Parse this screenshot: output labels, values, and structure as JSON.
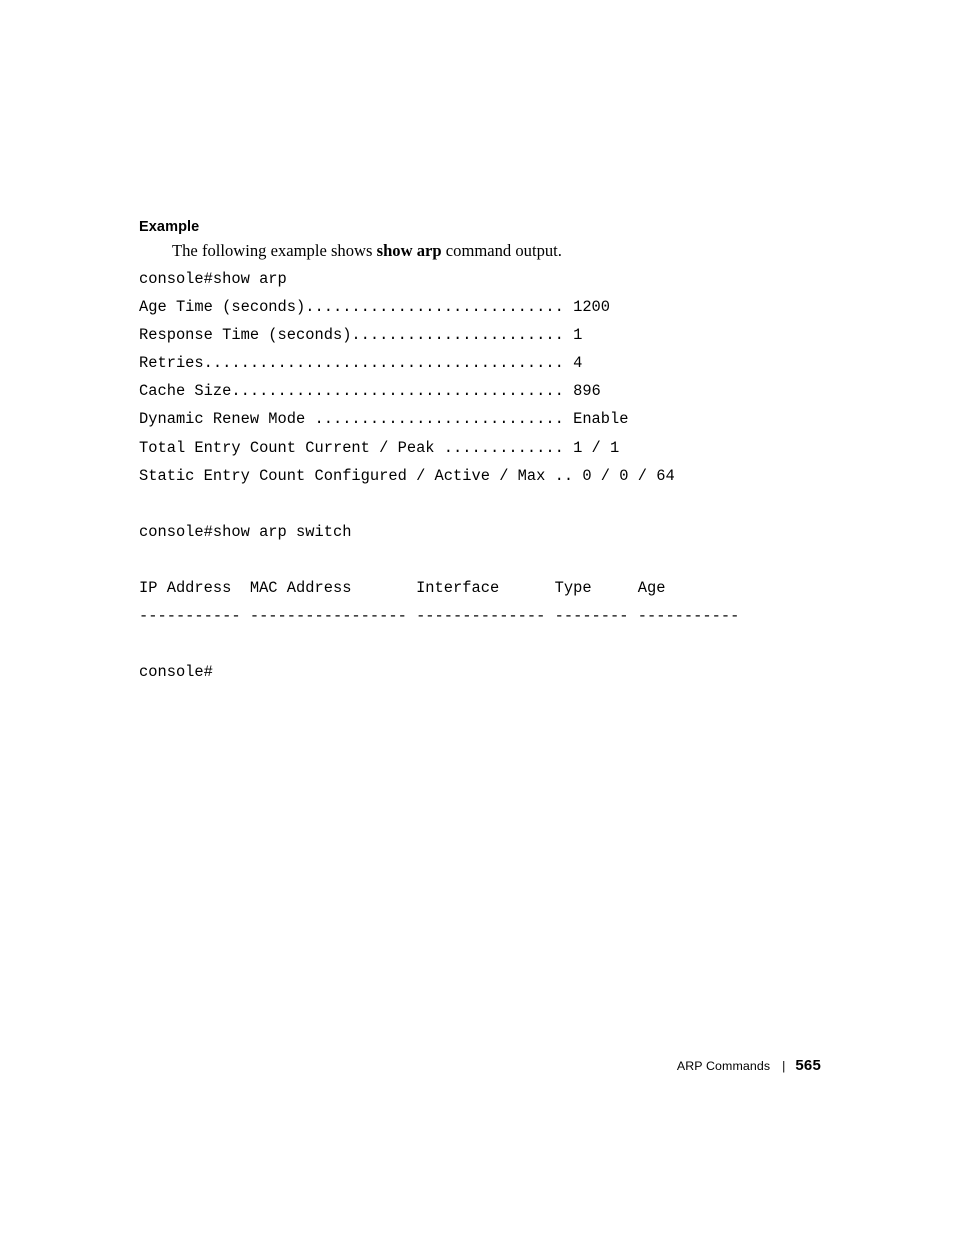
{
  "page": {
    "section_heading": "Example",
    "intro_prefix": "The following example shows ",
    "intro_bold": "show arp",
    "intro_suffix": " command output."
  },
  "console": {
    "lines": [
      "console#show arp",
      "Age Time (seconds)............................ 1200",
      "Response Time (seconds)....................... 1",
      "Retries....................................... 4",
      "Cache Size.................................... 896",
      "Dynamic Renew Mode ........................... Enable",
      "Total Entry Count Current / Peak ............. 1 / 1",
      "Static Entry Count Configured / Active / Max .. 0 / 0 / 64",
      "",
      "console#show arp switch",
      "",
      "IP Address  MAC Address       Interface      Type     Age",
      "----------- ----------------- -------------- -------- -----------",
      "",
      "console#"
    ]
  },
  "footer": {
    "label": "ARP Commands",
    "separator": "|",
    "page_number": "565"
  }
}
